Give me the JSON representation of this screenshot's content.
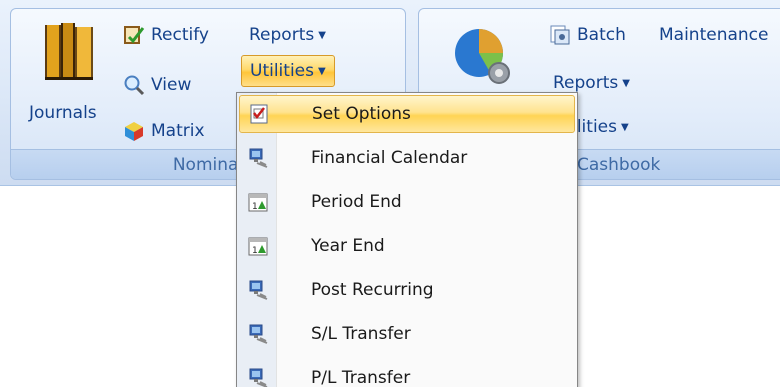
{
  "nominal_group": {
    "label": "Nominal",
    "journals_label": "Journals",
    "rectify_label": "Rectify",
    "view_label": "View",
    "matrix_label": "Matrix",
    "reports_label": "Reports",
    "utilities_label": "Utilities"
  },
  "cashbook_group": {
    "label": "Cashbook",
    "batch_label": "Batch",
    "maintenance_label": "Maintenance",
    "reports_label": "Reports",
    "utilities_label": "Utilities"
  },
  "utilities_menu": {
    "items": [
      {
        "label": "Set Options",
        "icon": "checklist-icon",
        "active": true
      },
      {
        "label": "Financial Calendar",
        "icon": "computer-icon"
      },
      {
        "label": "Period End",
        "icon": "calendar-icon"
      },
      {
        "label": "Year End",
        "icon": "calendar-icon"
      },
      {
        "label": "Post Recurring",
        "icon": "computer-icon"
      },
      {
        "label": "S/L Transfer",
        "icon": "computer-icon"
      },
      {
        "label": "P/L Transfer",
        "icon": "computer-icon"
      }
    ]
  },
  "colors": {
    "ribbon_text": "#15428b",
    "highlight": "#ffd454",
    "menu_bg": "#fafafa"
  }
}
